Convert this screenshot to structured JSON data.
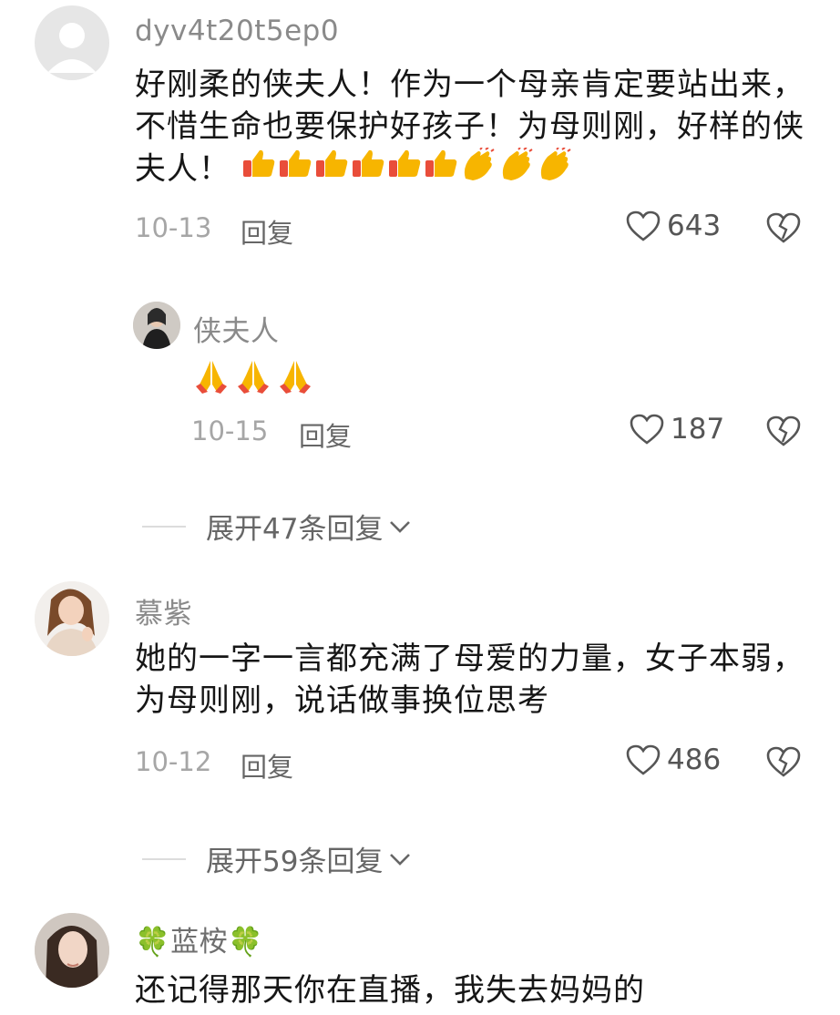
{
  "comments": [
    {
      "username": "dyv4t20t5ep0",
      "text": "好刚柔的侠夫人！作为一个母亲肯定要站出来，不惜生命也要保护好孩子！为母则刚，好样的侠夫人！",
      "emojis": [
        "thumbs-up",
        "thumbs-up",
        "thumbs-up",
        "thumbs-up",
        "thumbs-up",
        "thumbs-up",
        "clapping",
        "clapping",
        "clapping"
      ],
      "date": "10-13",
      "reply_label": "回复",
      "likes": "643"
    },
    {
      "username": "慕紫",
      "text": "她的一字一言都充满了母爱的力量，女子本弱，为母则刚，说话做事换位思考",
      "date": "10-12",
      "reply_label": "回复",
      "likes": "486"
    },
    {
      "username": "🍀蓝桉🍀",
      "text": "还记得那天你在直播，我失去妈妈的"
    }
  ],
  "reply": {
    "username": "侠夫人",
    "emojis": [
      "folded-hands",
      "folded-hands",
      "folded-hands"
    ],
    "date": "10-15",
    "reply_label": "回复",
    "likes": "187"
  },
  "expand": [
    {
      "label": "展开47条回复"
    },
    {
      "label": "展开59条回复"
    }
  ],
  "colors": {
    "username": "#8a8a8a",
    "text": "#161616",
    "date": "#a6a6a6",
    "reply_link": "#666666",
    "emoji_thumb": "#f7b500"
  }
}
